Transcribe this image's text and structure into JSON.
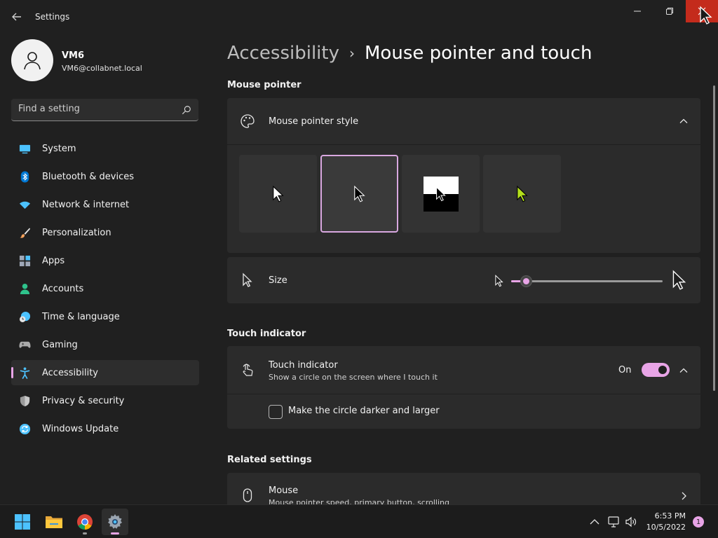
{
  "window": {
    "title": "Settings"
  },
  "profile": {
    "name": "VM6",
    "email": "VM6@collabnet.local"
  },
  "search": {
    "placeholder": "Find a setting"
  },
  "sidebar": {
    "items": [
      {
        "label": "System",
        "icon": "system-icon",
        "color": "#4cc2ff"
      },
      {
        "label": "Bluetooth & devices",
        "icon": "bluetooth-icon",
        "color": "#0078d4"
      },
      {
        "label": "Network & internet",
        "icon": "wifi-icon",
        "color": "#4cc2ff"
      },
      {
        "label": "Personalization",
        "icon": "brush-icon",
        "color": "#f7a25c"
      },
      {
        "label": "Apps",
        "icon": "apps-icon",
        "color": "#9fa8b8"
      },
      {
        "label": "Accounts",
        "icon": "accounts-icon",
        "color": "#2ec28b"
      },
      {
        "label": "Time & language",
        "icon": "clock-globe-icon",
        "color": "#4cc2ff"
      },
      {
        "label": "Gaming",
        "icon": "gamepad-icon",
        "color": "#a9a9a9"
      },
      {
        "label": "Accessibility",
        "icon": "accessibility-icon",
        "color": "#4cc2ff",
        "selected": true
      },
      {
        "label": "Privacy & security",
        "icon": "shield-icon",
        "color": "#9a9a9a"
      },
      {
        "label": "Windows Update",
        "icon": "update-icon",
        "color": "#4cc2ff"
      }
    ]
  },
  "breadcrumb": {
    "parent": "Accessibility",
    "separator": "›",
    "current": "Mouse pointer and touch"
  },
  "mouse_pointer": {
    "section_title": "Mouse pointer",
    "style_label": "Mouse pointer style",
    "style_options": [
      "white-pointer",
      "black-pointer",
      "inverted-pointer",
      "custom-color-pointer"
    ],
    "selected_style": 1,
    "custom_color": "#b4e01c",
    "size_label": "Size",
    "size_value": 0.1
  },
  "touch": {
    "section_title": "Touch indicator",
    "label": "Touch indicator",
    "description": "Show a circle on the screen where I touch it",
    "state": "On",
    "darker_label": "Make the circle darker and larger",
    "darker_checked": false
  },
  "related": {
    "section_title": "Related settings",
    "mouse_label": "Mouse",
    "mouse_description": "Mouse pointer speed, primary button, scrolling"
  },
  "taskbar": {
    "time": "6:53 PM",
    "date": "10/5/2022",
    "notification_count": "1"
  },
  "colors": {
    "accent": "#e8a4e6",
    "close_button": "#c42b1c",
    "background": "#202020",
    "card": "#2b2b2b"
  }
}
